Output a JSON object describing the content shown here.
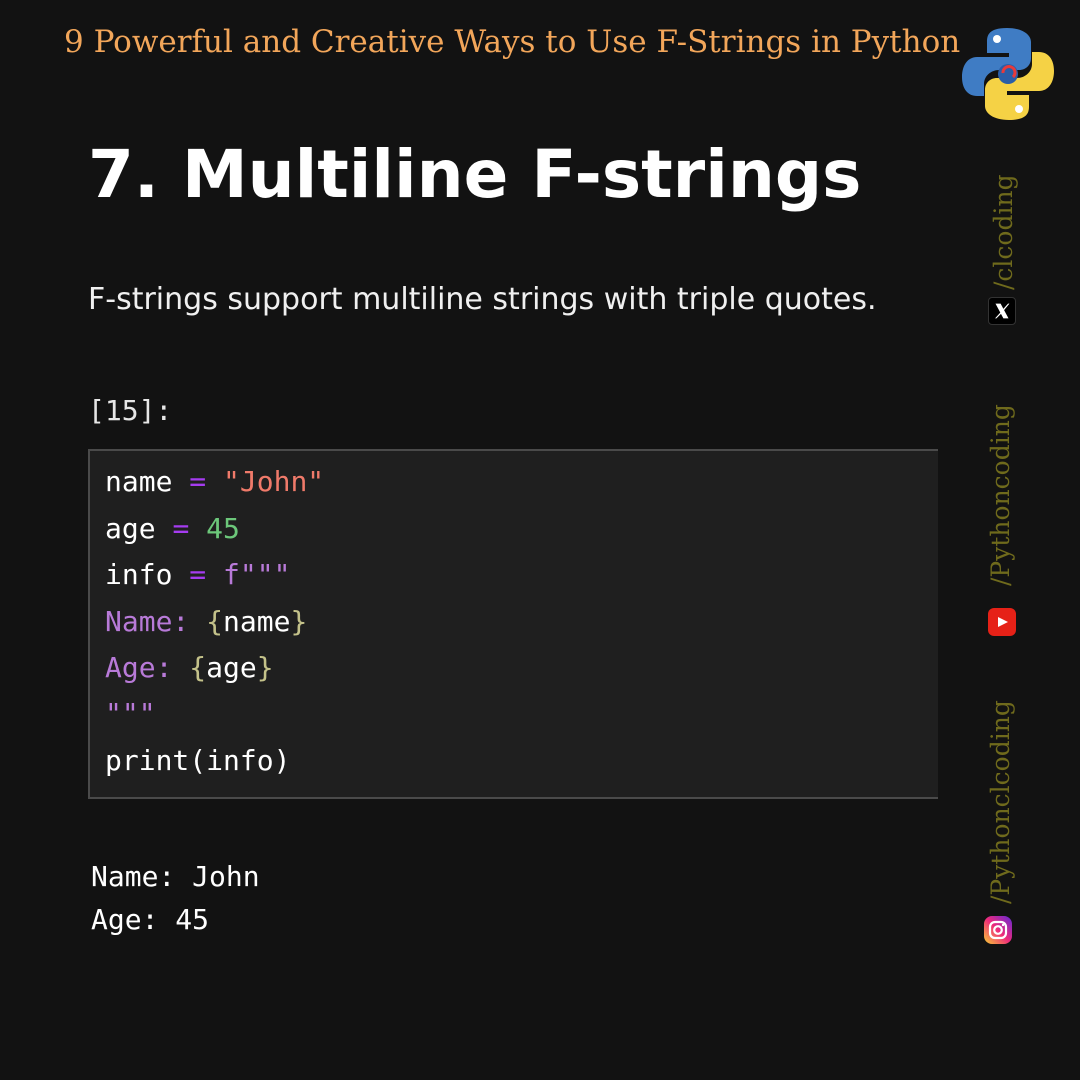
{
  "header": {
    "series_title": "9 Powerful and Creative Ways to Use F-Strings in Python",
    "logo_icon": "python-logo-icon"
  },
  "section": {
    "heading": "7. Multiline F-strings",
    "description": "F-strings support multiline strings with triple quotes."
  },
  "cell": {
    "prompt": "[15]:",
    "code": {
      "line1": {
        "var": "name",
        "op": "=",
        "val": "\"John\""
      },
      "line2": {
        "var": "age",
        "op": "=",
        "val": "45"
      },
      "line3": {
        "var": "info",
        "op": "=",
        "val": "f\"\"\""
      },
      "line4": {
        "label": "Name: ",
        "open": "{",
        "var": "name",
        "close": "}"
      },
      "line5": {
        "label": "Age: ",
        "open": "{",
        "var": "age",
        "close": "}"
      },
      "line6": "\"\"\"",
      "line7": "print(info)"
    },
    "output": [
      "Name: John",
      "Age: 45"
    ]
  },
  "social": {
    "x_handle": "/clcoding",
    "youtube_handle": "/Pythoncoding",
    "instagram_handle": "/Pythonclcoding",
    "icons": [
      "x-icon",
      "youtube-icon",
      "instagram-icon"
    ]
  },
  "colors": {
    "background": "#121212",
    "series_title": "#f2a65a",
    "operator": "#a53cf0",
    "string": "#f07a6a",
    "number": "#6cc77a",
    "handle": "#6f6a1c"
  }
}
